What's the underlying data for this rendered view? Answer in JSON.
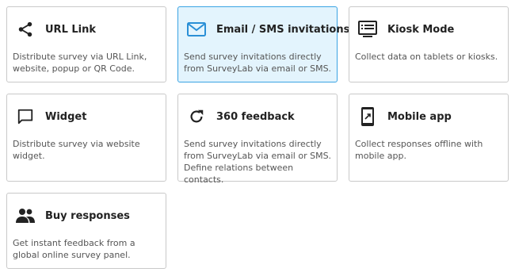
{
  "cards": [
    {
      "title": "URL Link",
      "description": "Distribute survey via URL Link, website, popup or QR Code.",
      "icon": "share-icon"
    },
    {
      "title": "Email / SMS invitations",
      "description": "Send survey invitations directly from SurveyLab via email or SMS.",
      "icon": "email-icon",
      "selected": true
    },
    {
      "title": "Kiosk Mode",
      "description": "Collect data on tablets or kiosks.",
      "icon": "kiosk-icon"
    },
    {
      "title": "Widget",
      "description": "Distribute survey via website widget.",
      "icon": "chat-bubble-icon"
    },
    {
      "title": "360 feedback",
      "description": "Send survey invitations directly from SurveyLab via email or SMS. Define relations between contacts.",
      "icon": "refresh-icon"
    },
    {
      "title": "Mobile app",
      "description": "Collect responses offline with mobile app.",
      "icon": "mobile-phone-icon"
    },
    {
      "title": "Buy responses",
      "description": "Get instant feedback from a global online survey panel.",
      "icon": "people-icon"
    }
  ],
  "colors": {
    "selected_background": "#e3f4fd",
    "selected_border": "#3aa3e3",
    "email_icon": "#2a8fd6",
    "icon_default": "#222222"
  }
}
